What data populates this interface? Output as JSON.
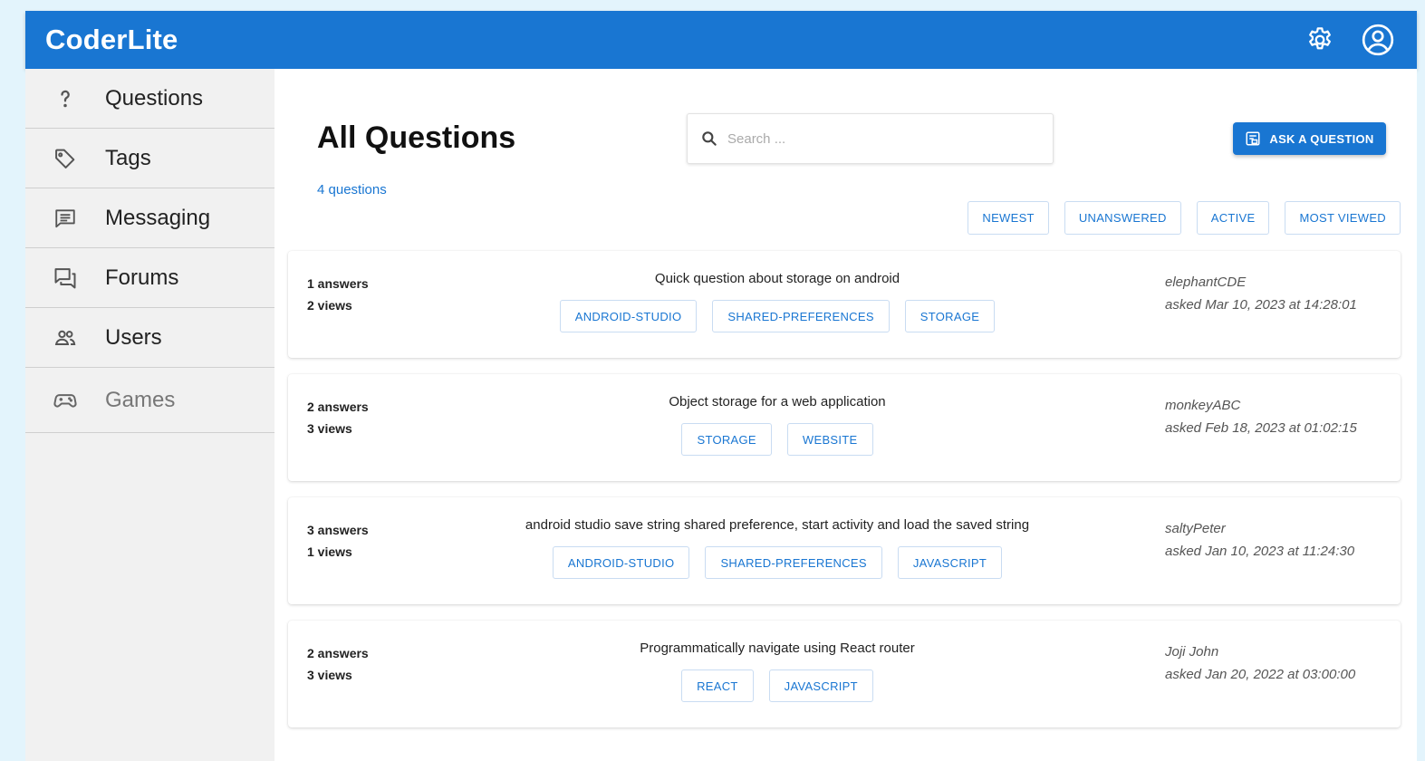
{
  "app": {
    "title": "CoderLite"
  },
  "header": {
    "settings_icon": "gear-icon",
    "account_icon": "account-circle-icon"
  },
  "sidebar": {
    "items": [
      {
        "label": "Questions",
        "icon": "question-mark-icon"
      },
      {
        "label": "Tags",
        "icon": "tag-icon"
      },
      {
        "label": "Messaging",
        "icon": "message-icon"
      },
      {
        "label": "Forums",
        "icon": "forum-icon"
      },
      {
        "label": "Users",
        "icon": "users-icon"
      },
      {
        "label": "Games",
        "icon": "gamepad-icon",
        "disabled": true
      }
    ]
  },
  "main": {
    "title": "All Questions",
    "count": "4 questions",
    "search_placeholder": "Search ...",
    "ask_button": "ASK A QUESTION",
    "filters": [
      "NEWEST",
      "UNANSWERED",
      "ACTIVE",
      "MOST VIEWED"
    ]
  },
  "questions": [
    {
      "answers": "1 answers",
      "views": "2 views",
      "title": "Quick question about storage on android",
      "tags": [
        "ANDROID-STUDIO",
        "SHARED-PREFERENCES",
        "STORAGE"
      ],
      "author": "elephantCDE",
      "asked": "asked Mar 10, 2023 at 14:28:01"
    },
    {
      "answers": "2 answers",
      "views": "3 views",
      "title": "Object storage for a web application",
      "tags": [
        "STORAGE",
        "WEBSITE"
      ],
      "author": "monkeyABC",
      "asked": "asked Feb 18, 2023 at 01:02:15"
    },
    {
      "answers": "3 answers",
      "views": "1 views",
      "title": "android studio save string shared preference, start activity and load the saved string",
      "tags": [
        "ANDROID-STUDIO",
        "SHARED-PREFERENCES",
        "JAVASCRIPT"
      ],
      "author": "saltyPeter",
      "asked": "asked Jan 10, 2023 at 11:24:30"
    },
    {
      "answers": "2 answers",
      "views": "3 views",
      "title": "Programmatically navigate using React router",
      "tags": [
        "REACT",
        "JAVASCRIPT"
      ],
      "author": "Joji John",
      "asked": "asked Jan 20, 2022 at 03:00:00"
    }
  ],
  "colors": {
    "primary": "#1976d2",
    "background": "#e3f4fc",
    "sidebar": "#f1f1f1"
  }
}
